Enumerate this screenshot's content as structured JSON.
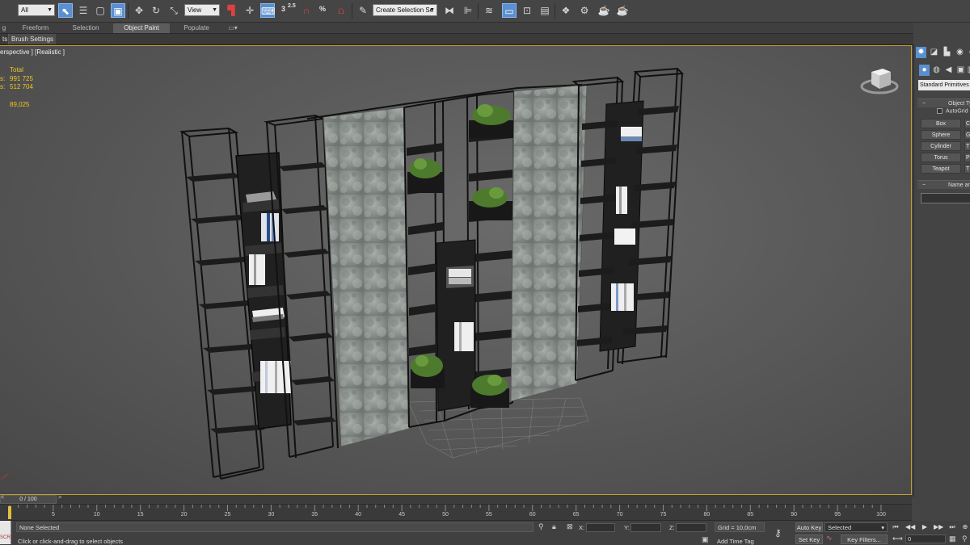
{
  "toolbar": {
    "filter_dropdown": "All",
    "ref_coord_dropdown": "View",
    "snap_angle": "2.5",
    "snap_percent": "%",
    "selection_set_placeholder": "Create Selection Se"
  },
  "ribbon": {
    "tabs": [
      "g",
      "Freeform",
      "Selection",
      "Object Paint",
      "Populate"
    ],
    "active_tab": "Object Paint",
    "sub_items": [
      "ts",
      "Brush Settings"
    ]
  },
  "viewport": {
    "label": "erspective ] [Realistic ]",
    "stats": {
      "header": "Total",
      "row1_label": "s:",
      "row1_value": "991 725",
      "row2_label": "s:",
      "row2_value": "512 704",
      "fps_value": "89,025"
    },
    "accent_color": "#c0a030"
  },
  "command_panel": {
    "category_dropdown": "Standard Primitives",
    "object_type_header": "Object Ty",
    "autogrid_label": "AutoGrid",
    "primitives": [
      "Box",
      "Sphere",
      "Cylinder",
      "Torus",
      "Teapot"
    ],
    "primitives_col2": [
      "C",
      "G",
      "T",
      "P",
      "T"
    ],
    "name_color_header": "Name and C"
  },
  "time_slider": {
    "frame_label": "0 / 100",
    "prev": "<",
    "next": ">"
  },
  "trackbar": {
    "ticks": [
      "5",
      "10",
      "15",
      "20",
      "25",
      "30",
      "35",
      "40",
      "45",
      "50",
      "55",
      "60",
      "65",
      "70",
      "75",
      "80",
      "85",
      "90",
      "95",
      "100"
    ]
  },
  "status": {
    "maxscript_label": "SCRI",
    "selection_text": "None Selected",
    "prompt_text": "Click or click-and-drag to select objects",
    "x_label": "X:",
    "y_label": "Y:",
    "z_label": "Z:",
    "grid_text": "Grid = 10,0cm",
    "add_time_tag": "Add Time Tag",
    "auto_key": "Auto Key",
    "set_key": "Set Key",
    "selected_dropdown": "Selected",
    "key_filters": "Key Filters...",
    "current_frame": "0"
  }
}
